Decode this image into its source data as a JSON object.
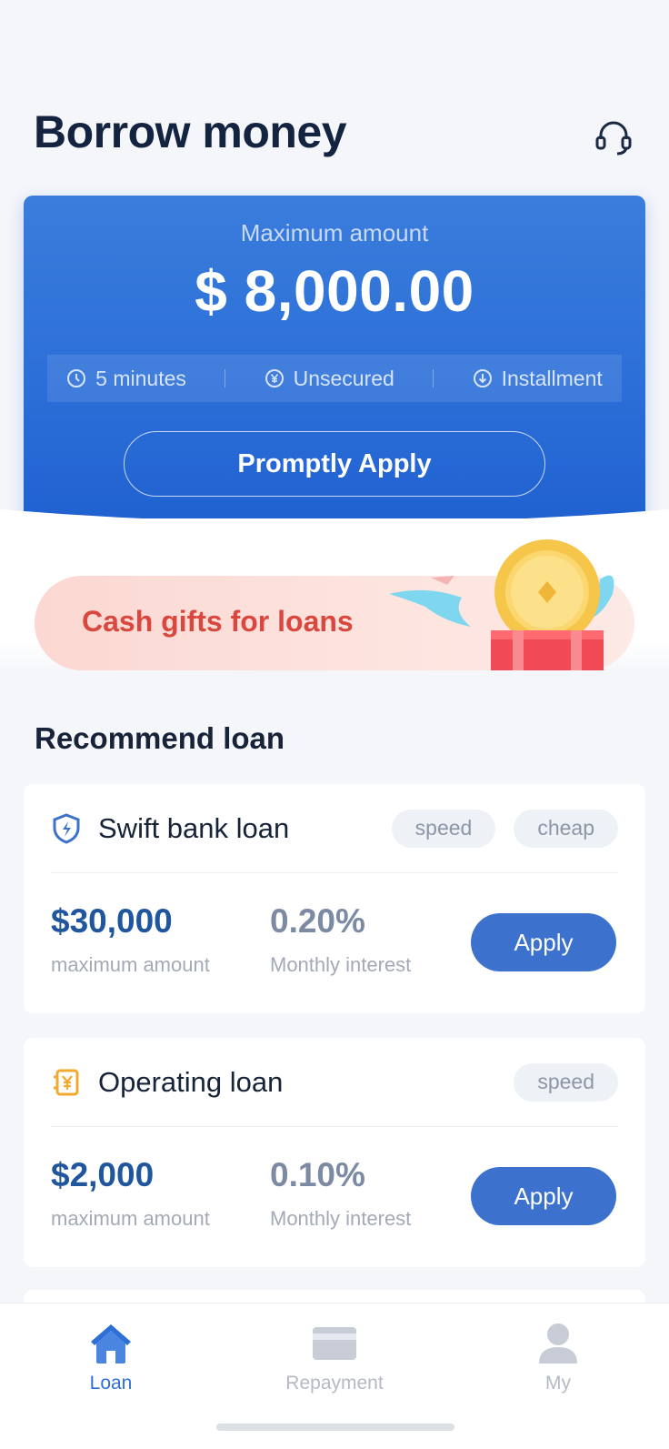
{
  "header": {
    "title": "Borrow money",
    "support_icon": "headset-icon"
  },
  "hero": {
    "label": "Maximum amount",
    "amount": "$ 8,000.00",
    "features": [
      {
        "icon": "clock-icon",
        "label": "5 minutes"
      },
      {
        "icon": "yen-coin-icon",
        "label": "Unsecured"
      },
      {
        "icon": "download-circle-icon",
        "label": "Installment"
      }
    ],
    "apply_label": "Promptly Apply"
  },
  "promo": {
    "text": "Cash gifts for loans"
  },
  "recommend": {
    "title": "Recommend loan",
    "loans": [
      {
        "name": "Swift bank loan",
        "icon": "shield-icon",
        "tags": [
          "speed",
          "cheap"
        ],
        "amount": "$30,000",
        "amount_label": "maximum amount",
        "rate": "0.20%",
        "rate_label": "Monthly interest",
        "apply_label": "Apply"
      },
      {
        "name": "Operating loan",
        "icon": "yen-receipt-icon",
        "tags": [
          "speed"
        ],
        "amount": "$2,000",
        "amount_label": "maximum amount",
        "rate": "0.10%",
        "rate_label": "Monthly interest",
        "apply_label": "Apply"
      }
    ]
  },
  "nav": {
    "items": [
      {
        "label": "Loan",
        "icon": "home-icon",
        "active": true
      },
      {
        "label": "Repayment",
        "icon": "card-icon",
        "active": false
      },
      {
        "label": "My",
        "icon": "user-icon",
        "active": false
      }
    ]
  },
  "colors": {
    "primary": "#2e6fd6",
    "hero_top": "#3a7ddc",
    "hero_bottom": "#1f60d0",
    "promo_text": "#d9473e",
    "amount_text": "#20569e"
  }
}
